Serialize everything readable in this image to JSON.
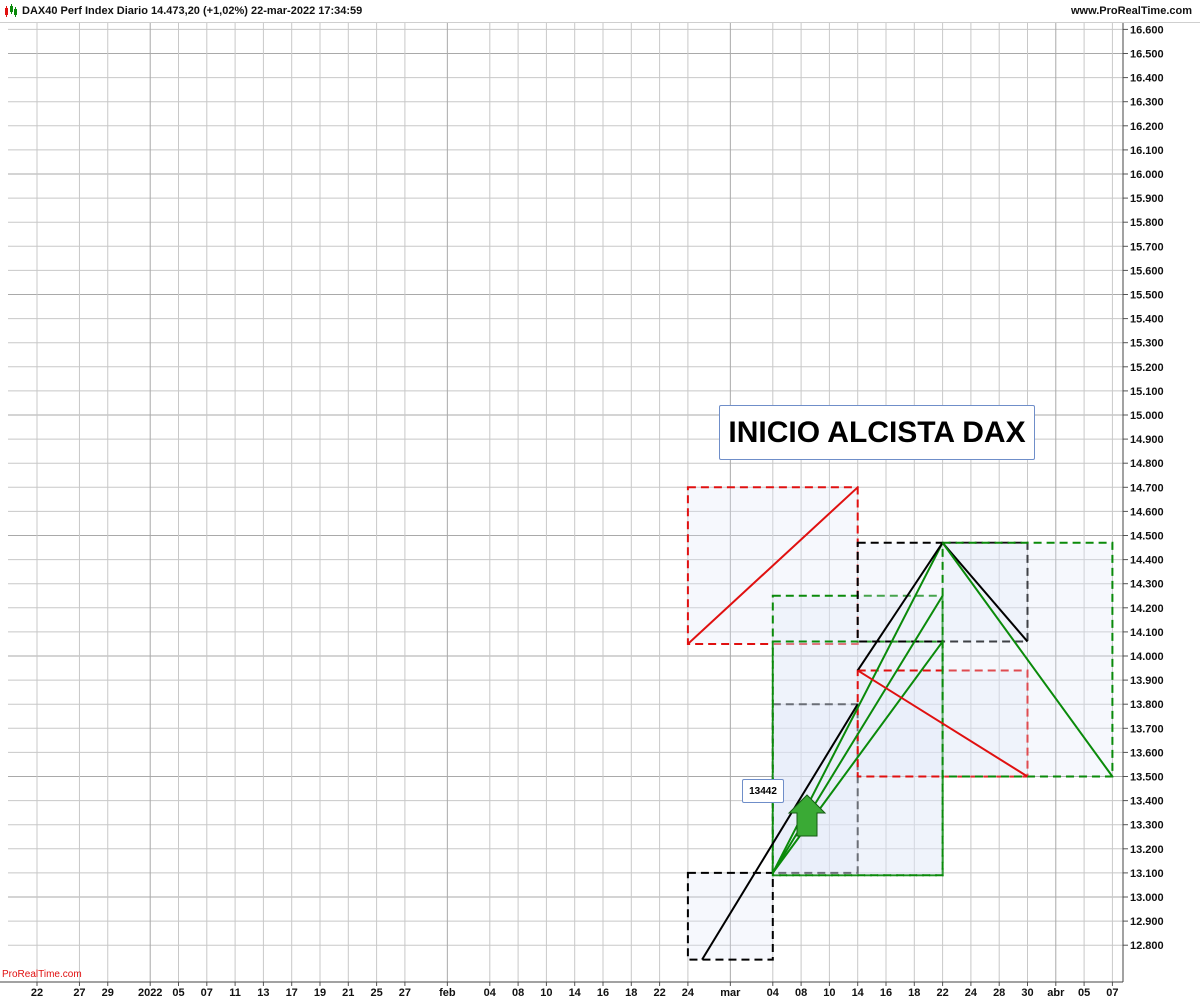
{
  "header": {
    "title": "DAX40 Perf Index Diario 14.473,20 (+1,02%) 22-mar-2022 17:34:59",
    "brand": "www.ProRealTime.com",
    "icon": "candlestick-icon"
  },
  "watermark": "ProRealTime.com",
  "annotations": {
    "banner": "INICIO ALCISTA DAX",
    "price_tag": "13442",
    "arrow": "up-arrow-icon"
  },
  "colors": {
    "red": "#e01010",
    "green": "#0a8a0a",
    "black": "#000000",
    "box_fill": "#dfe6f7",
    "arrow_fill": "#3aaa35",
    "grid": "#c8c8c8"
  },
  "chart_data": {
    "type": "line",
    "title": "DAX40 Perf Index Diario",
    "y_ticks": [
      "12.800",
      "12.900",
      "13.000",
      "13.100",
      "13.200",
      "13.300",
      "13.400",
      "13.500",
      "13.600",
      "13.700",
      "13.800",
      "13.900",
      "14.000",
      "14.100",
      "14.200",
      "14.300",
      "14.400",
      "14.500",
      "14.600",
      "14.700",
      "14.800",
      "14.900",
      "15.000",
      "15.100",
      "15.200",
      "15.300",
      "15.400",
      "15.500",
      "15.600",
      "15.700",
      "15.800",
      "15.900",
      "16.000",
      "16.100",
      "16.200",
      "16.300",
      "16.400",
      "16.500",
      "16.600"
    ],
    "ylim": [
      12740,
      16650
    ],
    "x_ticks": [
      "22",
      "27",
      "29",
      "2022",
      "05",
      "07",
      "11",
      "13",
      "17",
      "19",
      "21",
      "25",
      "27",
      "feb",
      "04",
      "08",
      "10",
      "14",
      "16",
      "18",
      "22",
      "24",
      "mar",
      "04",
      "08",
      "10",
      "14",
      "16",
      "18",
      "22",
      "24",
      "28",
      "30",
      "abr",
      "05",
      "07"
    ],
    "x_dates": [
      "2021-12-22",
      "2021-12-27",
      "2021-12-29",
      "2022-01-03",
      "2022-01-05",
      "2022-01-07",
      "2022-01-11",
      "2022-01-13",
      "2022-01-17",
      "2022-01-19",
      "2022-01-21",
      "2022-01-25",
      "2022-01-27",
      "2022-02-01",
      "2022-02-04",
      "2022-02-08",
      "2022-02-10",
      "2022-02-14",
      "2022-02-16",
      "2022-02-18",
      "2022-02-22",
      "2022-02-24",
      "2022-03-01",
      "2022-03-04",
      "2022-03-08",
      "2022-03-10",
      "2022-03-14",
      "2022-03-16",
      "2022-03-18",
      "2022-03-22",
      "2022-03-24",
      "2022-03-28",
      "2022-03-30",
      "2022-04-01",
      "2022-04-05",
      "2022-04-07"
    ],
    "boxes": [
      {
        "x0": "2022-02-24",
        "x1": "2022-03-14",
        "y0": 14050,
        "y1": 14700,
        "color": "red"
      },
      {
        "x0": "2022-02-24",
        "x1": "2022-03-04",
        "y0": 12740,
        "y1": 13100,
        "color": "black"
      },
      {
        "x0": "2022-03-04",
        "x1": "2022-03-14",
        "y0": 13100,
        "y1": 13800,
        "color": "black"
      },
      {
        "x0": "2022-03-04",
        "x1": "2022-03-22",
        "y0": 13090,
        "y1": 14250,
        "color": "green"
      },
      {
        "x0": "2022-03-04",
        "x1": "2022-03-22",
        "y0": 13090,
        "y1": 14060,
        "color": "green"
      },
      {
        "x0": "2022-03-14",
        "x1": "2022-03-30",
        "y0": 14060,
        "y1": 14470,
        "color": "black"
      },
      {
        "x0": "2022-03-14",
        "x1": "2022-03-30",
        "y0": 13500,
        "y1": 13940,
        "color": "red"
      },
      {
        "x0": "2022-03-22",
        "x1": "2022-04-07",
        "y0": 13500,
        "y1": 14470,
        "color": "green"
      }
    ],
    "lines": [
      {
        "x0": "2022-02-24",
        "y0": 14050,
        "x1": "2022-03-14",
        "y1": 14700,
        "color": "red"
      },
      {
        "x0": "2022-02-25",
        "y0": 12740,
        "x1": "2022-03-14",
        "y1": 13800,
        "color": "black"
      },
      {
        "x0": "2022-03-04",
        "y0": 13100,
        "x1": "2022-03-22",
        "y1": 14250,
        "color": "green"
      },
      {
        "x0": "2022-03-04",
        "y0": 13100,
        "x1": "2022-03-22",
        "y1": 14060,
        "color": "green"
      },
      {
        "x0": "2022-03-04",
        "y0": 13100,
        "x1": "2022-03-22",
        "y1": 14470,
        "color": "green"
      },
      {
        "x0": "2022-03-14",
        "y0": 13940,
        "x1": "2022-03-22",
        "y1": 14470,
        "color": "black"
      },
      {
        "x0": "2022-03-22",
        "y0": 14470,
        "x1": "2022-03-30",
        "y1": 14060,
        "color": "black"
      },
      {
        "x0": "2022-03-14",
        "y0": 13940,
        "x1": "2022-03-30",
        "y1": 13500,
        "color": "red"
      },
      {
        "x0": "2022-03-22",
        "y0": 14470,
        "x1": "2022-04-07",
        "y1": 13500,
        "color": "green"
      }
    ],
    "grid": true
  }
}
